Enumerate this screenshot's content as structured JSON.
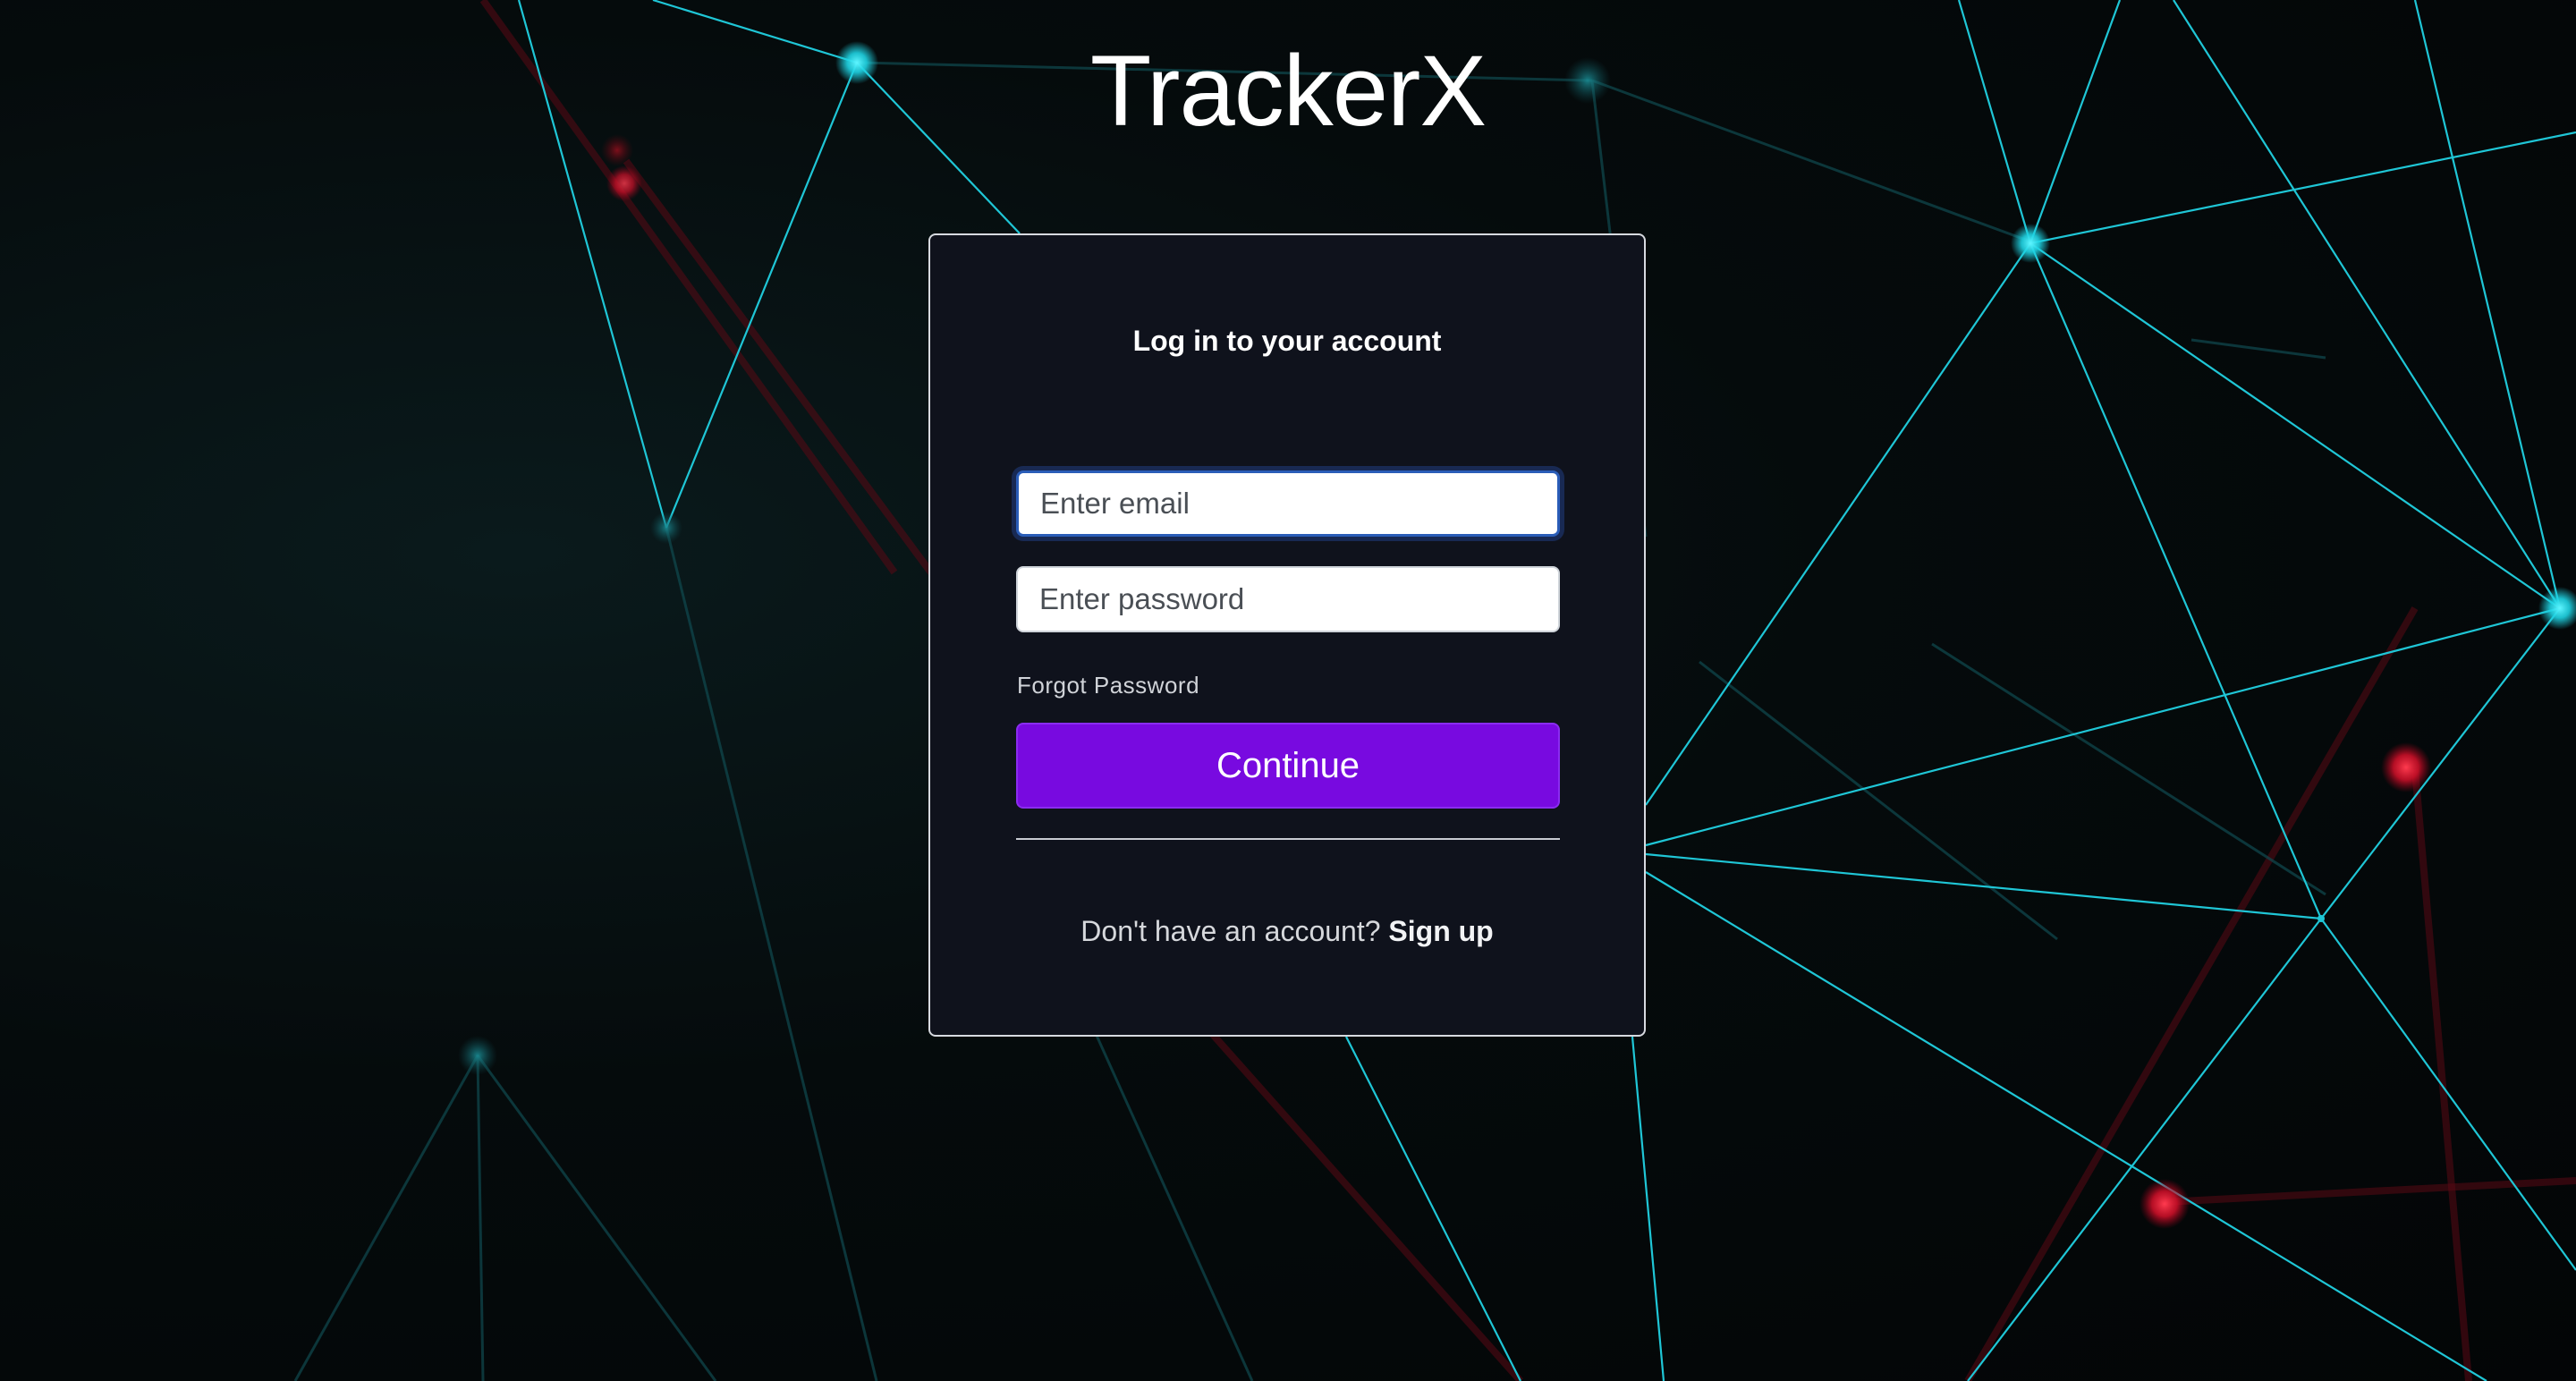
{
  "app": {
    "title": "TrackerX"
  },
  "login": {
    "heading": "Log in to your account",
    "email_placeholder": "Enter email",
    "password_placeholder": "Enter password",
    "forgot_password": "Forgot Password",
    "continue_label": "Continue",
    "signup_prompt": "Don't have an account?",
    "signup_link": "Sign up"
  },
  "colors": {
    "background": "#040708",
    "card_background": "#0f121c",
    "accent_button": "#780ae0",
    "network_cyan": "#1fd3e3",
    "network_red": "#e0142c",
    "focus_ring": "#2a5db8"
  }
}
